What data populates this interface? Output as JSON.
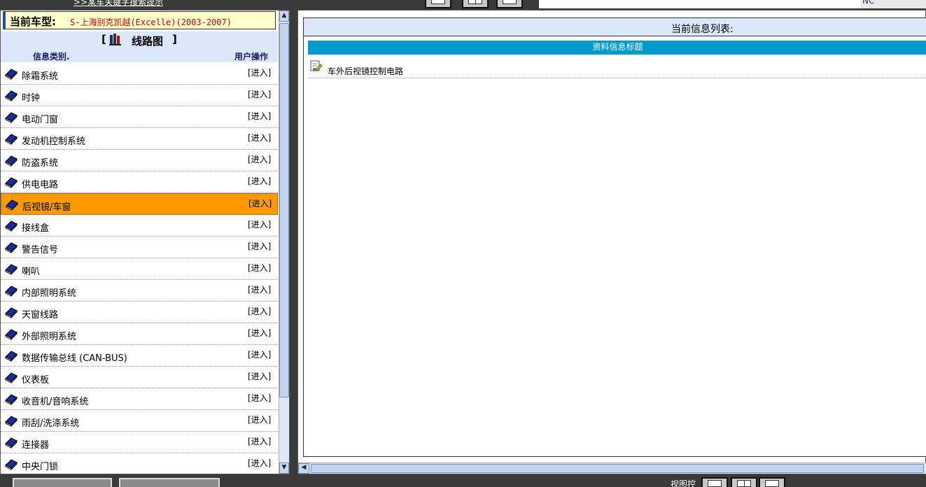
{
  "top": {
    "link_text": ">>某车关键字搜索提示",
    "corner_text": "NC"
  },
  "car": {
    "label": "当前车型:",
    "value": "S-上海别克凯越(Excelle)(2003-2007)"
  },
  "section": {
    "open": "[",
    "title": "线路图",
    "close": "]",
    "col_category": "信息类别.",
    "col_action": "用户操作"
  },
  "categories": [
    {
      "name": "除霜系统",
      "action": "[进入]"
    },
    {
      "name": "时钟",
      "action": "[进入]"
    },
    {
      "name": "电动门窗",
      "action": "[进入]"
    },
    {
      "name": "发动机控制系统",
      "action": "[进入]"
    },
    {
      "name": "防盗系统",
      "action": "[进入]"
    },
    {
      "name": "供电电路",
      "action": "[进入]"
    },
    {
      "name": "后视镜/车窗",
      "action": "[进入]",
      "selected": true
    },
    {
      "name": "接线盒",
      "action": "[进入]"
    },
    {
      "name": "警告信号",
      "action": "[进入]"
    },
    {
      "name": "喇叭",
      "action": "[进入]"
    },
    {
      "name": "内部照明系统",
      "action": "[进入]"
    },
    {
      "name": "天窗线路",
      "action": "[进入]"
    },
    {
      "name": "外部照明系统",
      "action": "[进入]"
    },
    {
      "name": "数据传输总线 (CAN-BUS)",
      "action": "[进入]"
    },
    {
      "name": "仪表板",
      "action": "[进入]"
    },
    {
      "name": "收音机/音响系统",
      "action": "[进入]"
    },
    {
      "name": "雨刮/洗涤系统",
      "action": "[进入]"
    },
    {
      "name": "连接器",
      "action": "[进入]"
    },
    {
      "name": "中央门锁",
      "action": "[进入]"
    }
  ],
  "right": {
    "list_title": "当前信息列表:",
    "info_header": "资料信息标题",
    "documents": [
      {
        "name": "车外后视镜控制电路"
      }
    ]
  },
  "bottom": {
    "view_label": "视图控"
  },
  "colors": {
    "selected_row": "#ff9900",
    "info_header": "#0099cc",
    "panel_header": "#dbe8fb",
    "car_value": "#cc0000"
  },
  "icons": [
    "book-icon",
    "folder-book-icon",
    "document-edit-icon",
    "chevron-up-icon",
    "chevron-down-icon",
    "chevron-left-icon"
  ]
}
